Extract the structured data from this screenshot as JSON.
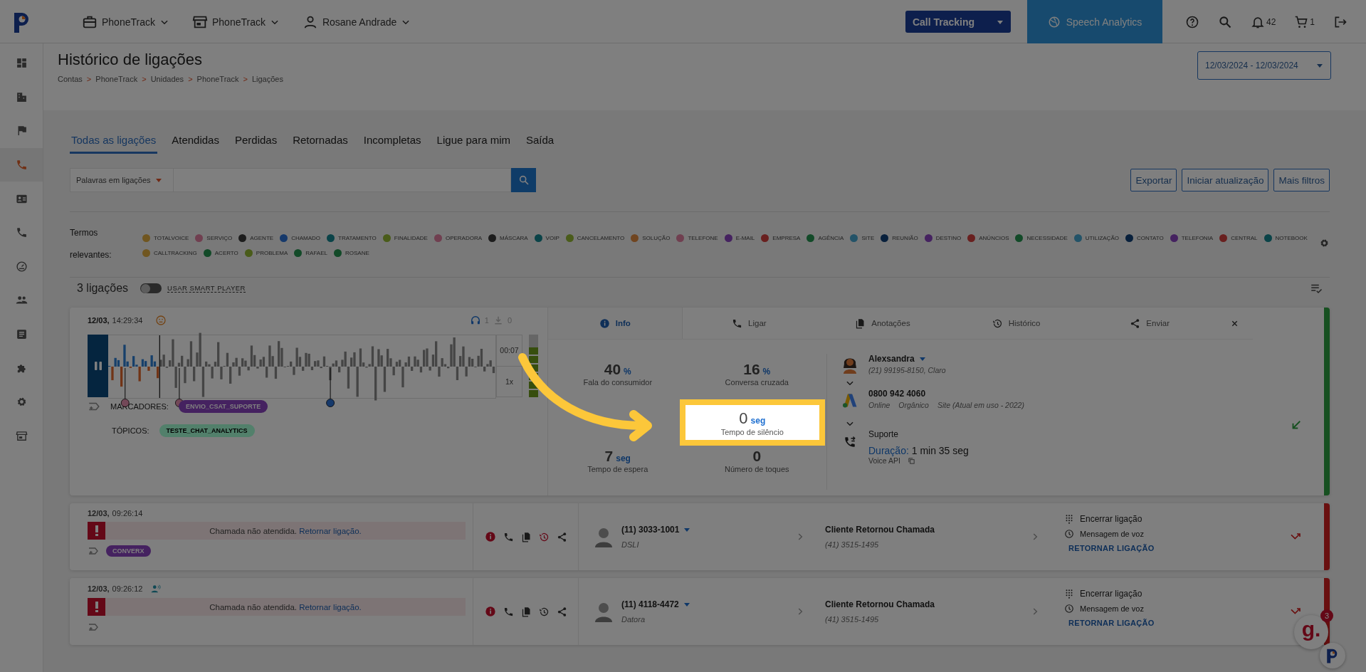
{
  "topbar": {
    "menus": [
      {
        "label": "PhoneTrack"
      },
      {
        "label": "PhoneTrack"
      },
      {
        "label": "Rosane Andrade"
      }
    ],
    "product": "Call Tracking",
    "module": "Speech Analytics",
    "notifications": "42",
    "cart": "1"
  },
  "sidebar": {
    "items": [
      {
        "selected": false
      },
      {
        "selected": false
      },
      {
        "selected": false
      },
      {
        "selected": true
      },
      {
        "selected": false
      },
      {
        "selected": false
      },
      {
        "selected": false
      },
      {
        "selected": false
      },
      {
        "selected": false
      },
      {
        "selected": false
      },
      {
        "selected": false
      },
      {
        "selected": false
      }
    ]
  },
  "header": {
    "title": "Histórico de ligações",
    "breadcrumbs": [
      "Contas",
      "PhoneTrack",
      "Unidades",
      "PhoneTrack",
      "Ligações"
    ],
    "separator": ">",
    "date_range": "12/03/2024 - 12/03/2024"
  },
  "tabs": [
    {
      "label": "Todas as ligações",
      "selected": true
    },
    {
      "label": "Atendidas",
      "selected": false
    },
    {
      "label": "Perdidas",
      "selected": false
    },
    {
      "label": "Retornadas",
      "selected": false
    },
    {
      "label": "Incompletas",
      "selected": false
    },
    {
      "label": "Ligue para mim",
      "selected": false
    },
    {
      "label": "Saída",
      "selected": false
    }
  ],
  "search": {
    "filter": "Palavras em ligações"
  },
  "buttons": [
    "Exportar",
    "Iniciar atualização",
    "Mais filtros"
  ],
  "terms": {
    "label": "Termos relevantes:",
    "items": [
      {
        "label": "TOTALVOICE",
        "color": "#705620"
      },
      {
        "label": "SERVIÇO",
        "color": "#703f50"
      },
      {
        "label": "AGENTE",
        "color": "#1d1d1d"
      },
      {
        "label": "CHAMADO",
        "color": "#16396b"
      },
      {
        "label": "TRATAMENTO",
        "color": "#0a4348"
      },
      {
        "label": "FINALIDADE",
        "color": "#4a5c1a"
      },
      {
        "label": "OPERADORA",
        "color": "#703f50"
      },
      {
        "label": "MÁSCARA",
        "color": "#1d1d1d"
      },
      {
        "label": "VOIP",
        "color": "#0a4348"
      },
      {
        "label": "CANCELAMENTO",
        "color": "#4a5c1a"
      },
      {
        "label": "SOLUÇÃO",
        "color": "#704520"
      },
      {
        "label": "TELEFONE",
        "color": "#703f50"
      },
      {
        "label": "E-MAIL",
        "color": "#452260"
      },
      {
        "label": "EMPRESA",
        "color": "#69201f"
      },
      {
        "label": "AGÊNCIA",
        "color": "#124a28"
      },
      {
        "label": "SITE",
        "color": "#235368"
      },
      {
        "label": "REUNIÃO",
        "color": "#08203c"
      },
      {
        "label": "DESTINO",
        "color": "#452260"
      },
      {
        "label": "ANÚNCIOS",
        "color": "#69201f"
      },
      {
        "label": "NECESSIDADE",
        "color": "#124a28"
      },
      {
        "label": "UTILIZAÇÃO",
        "color": "#235368"
      },
      {
        "label": "CONTATO",
        "color": "#08203c"
      },
      {
        "label": "TELEFONIA",
        "color": "#452260"
      },
      {
        "label": "CENTRAL",
        "color": "#69201f"
      },
      {
        "label": "NOTEBOOK",
        "color": "#0a4348"
      },
      {
        "label": "CALLTRACKING",
        "color": "#705620"
      },
      {
        "label": "ACERTO",
        "color": "#124a28"
      },
      {
        "label": "PROBLEMA",
        "color": "#4a5c1a"
      },
      {
        "label": "RAFAEL",
        "color": "#124a28"
      },
      {
        "label": "ROSANE",
        "color": "#124a28"
      }
    ]
  },
  "count": "3 ligações",
  "smart_player": {
    "label": "USAR SMART PLAYER",
    "on": false
  },
  "expanded_call": {
    "date": "12/03,",
    "time": "14:29:34",
    "listens": "1",
    "downloads": "0",
    "player": {
      "time": "00:07",
      "speed": "1x",
      "level": 0.13,
      "volume": {
        "level": 0.8
      },
      "pins": [
        {
          "color": "#734858"
        },
        {
          "color": "#734858"
        },
        {
          "color": "#16396b"
        }
      ]
    },
    "markers_label": "MARCADORES:",
    "markers": [
      {
        "label": "ENVIO_CSAT_SUPORTE",
        "color": "#452260"
      }
    ],
    "topics_label": "TÓPICOS:",
    "topics": [
      {
        "label": "TESTE_CHAT_ANALYTICS",
        "color": "#52806b"
      }
    ],
    "detail_tabs": [
      {
        "label": "Info",
        "selected": true
      },
      {
        "label": "Ligar",
        "selected": false
      },
      {
        "label": "Anotações",
        "selected": false
      },
      {
        "label": "Histórico",
        "selected": false
      },
      {
        "label": "Enviar",
        "selected": false
      }
    ],
    "stats_top": [
      {
        "value": "40",
        "unit": "%",
        "label": "Fala do consumidor"
      },
      {
        "value": "16",
        "unit": "%",
        "label": "Conversa cruzada"
      }
    ],
    "stats_bottom": [
      {
        "value": "7",
        "unit": "seg",
        "label": "Tempo de espera"
      },
      {
        "value": "0",
        "label": "Número de toques"
      }
    ],
    "contact": {
      "name": "Alexsandra",
      "phone": "(21) 99195-8150, Claro",
      "number": "0800 942 4060",
      "sources": [
        "Online",
        "Orgânico",
        "Site (Atual em uso - 2022)"
      ],
      "department": "Suporte",
      "duration_label": "Duração:",
      "duration": "1 min 35 seg",
      "provider": "Voice API"
    }
  },
  "calls": [
    {
      "date": "12/03,",
      "time": "09:26:14",
      "agent_speaking": false,
      "message": "Chamada não atendida.",
      "link": "Retornar ligação.",
      "tags": [
        {
          "label": "CONVERX",
          "color": "#452260"
        }
      ],
      "history_alert": true,
      "caller": "(11) 3033-1001",
      "caller_sub": "DSLI",
      "destination": "Cliente Retornou Chamada",
      "destination_phone": "(41) 3515-1495",
      "end": "Encerrar ligação",
      "voicemail": "Mensagem de voz",
      "return": "RETORNAR LIGAÇÃO"
    },
    {
      "date": "12/03,",
      "time": "09:26:12",
      "agent_speaking": true,
      "message": "Chamada não atendida.",
      "link": "Retornar ligação.",
      "history_alert": false,
      "caller": "(11) 4118-4472",
      "caller_sub": "Datora",
      "destination": "Cliente Retornou Chamada",
      "destination_phone": "(41) 3515-1495",
      "end": "Encerrar ligação",
      "voicemail": "Mensagem de voz",
      "return": "RETORNAR LIGAÇÃO"
    }
  ],
  "callout": {
    "value": "0",
    "unit": "seg",
    "label": "Tempo de silêncio"
  },
  "chat_widget": {
    "label": "g.",
    "badge": "3"
  }
}
